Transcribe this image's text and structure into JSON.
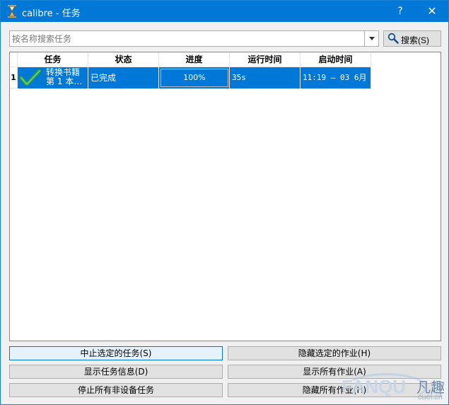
{
  "window": {
    "title": "calibre - 任务",
    "help_label": "?",
    "close_label": "✕",
    "accent": "#0078d7"
  },
  "search": {
    "placeholder": "按名称搜索任务",
    "button_label": "搜索(S)"
  },
  "table": {
    "columns": [
      "任务",
      "状态",
      "进度",
      "运行时间",
      "启动时间"
    ],
    "rows": [
      {
        "index": "1",
        "task_line1": "转换书籍",
        "task_line2": "第 1 本…",
        "status": "已完成",
        "progress_text": "100%",
        "progress_fraction": 1.0,
        "run_time": "35s",
        "start_time": "11:19 — 03 6月",
        "icon": "check-icon"
      }
    ]
  },
  "buttons": {
    "stop_selected": "中止选定的任务(S)",
    "hide_selected": "隐藏选定的作业(H)",
    "show_info": "显示任务信息(D)",
    "show_all": "显示所有作业(A)",
    "stop_non_device": "停止所有非设备任务",
    "hide_all": "隐藏所有作业(H)"
  },
  "watermark": {
    "brand_latin": "FANQU",
    "brand_cn": "凡趣",
    "url": "cuel.cn"
  }
}
